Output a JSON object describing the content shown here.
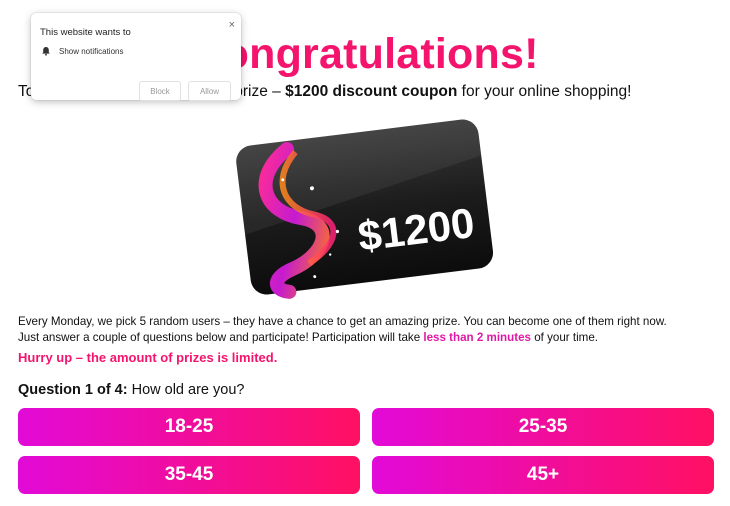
{
  "headline": "Congratulations!",
  "intro": {
    "prefix": "Today you can win an amazing prize – ",
    "bold": "$1200 discount coupon",
    "suffix": " for your online shopping!"
  },
  "card": {
    "amount": "$1200"
  },
  "description": {
    "line1": "Every Monday, we pick 5 random users – they have a chance to get an amazing prize. You can become one of them right now.",
    "line2_prefix": "Just answer a couple of questions below and participate! Participation will take ",
    "line2_highlight": "less than 2 minutes",
    "line2_suffix": " of your time."
  },
  "hurry": "Hurry up – the amount of prizes is limited.",
  "question": {
    "label": "Question 1 of 4:",
    "text": " How old are you?"
  },
  "options": [
    "18-25",
    "25-35",
    "35-45",
    "45+"
  ],
  "notification": {
    "title": "This website wants to",
    "permission": "Show notifications",
    "block_label": "Block",
    "allow_label": "Allow",
    "close_icon": "×",
    "bell_icon": "bell-icon"
  },
  "colors": {
    "accent": "#f4146d",
    "gradient_start": "#e20ad8",
    "gradient_end": "#ff1062",
    "highlight": "#e01aa6"
  }
}
